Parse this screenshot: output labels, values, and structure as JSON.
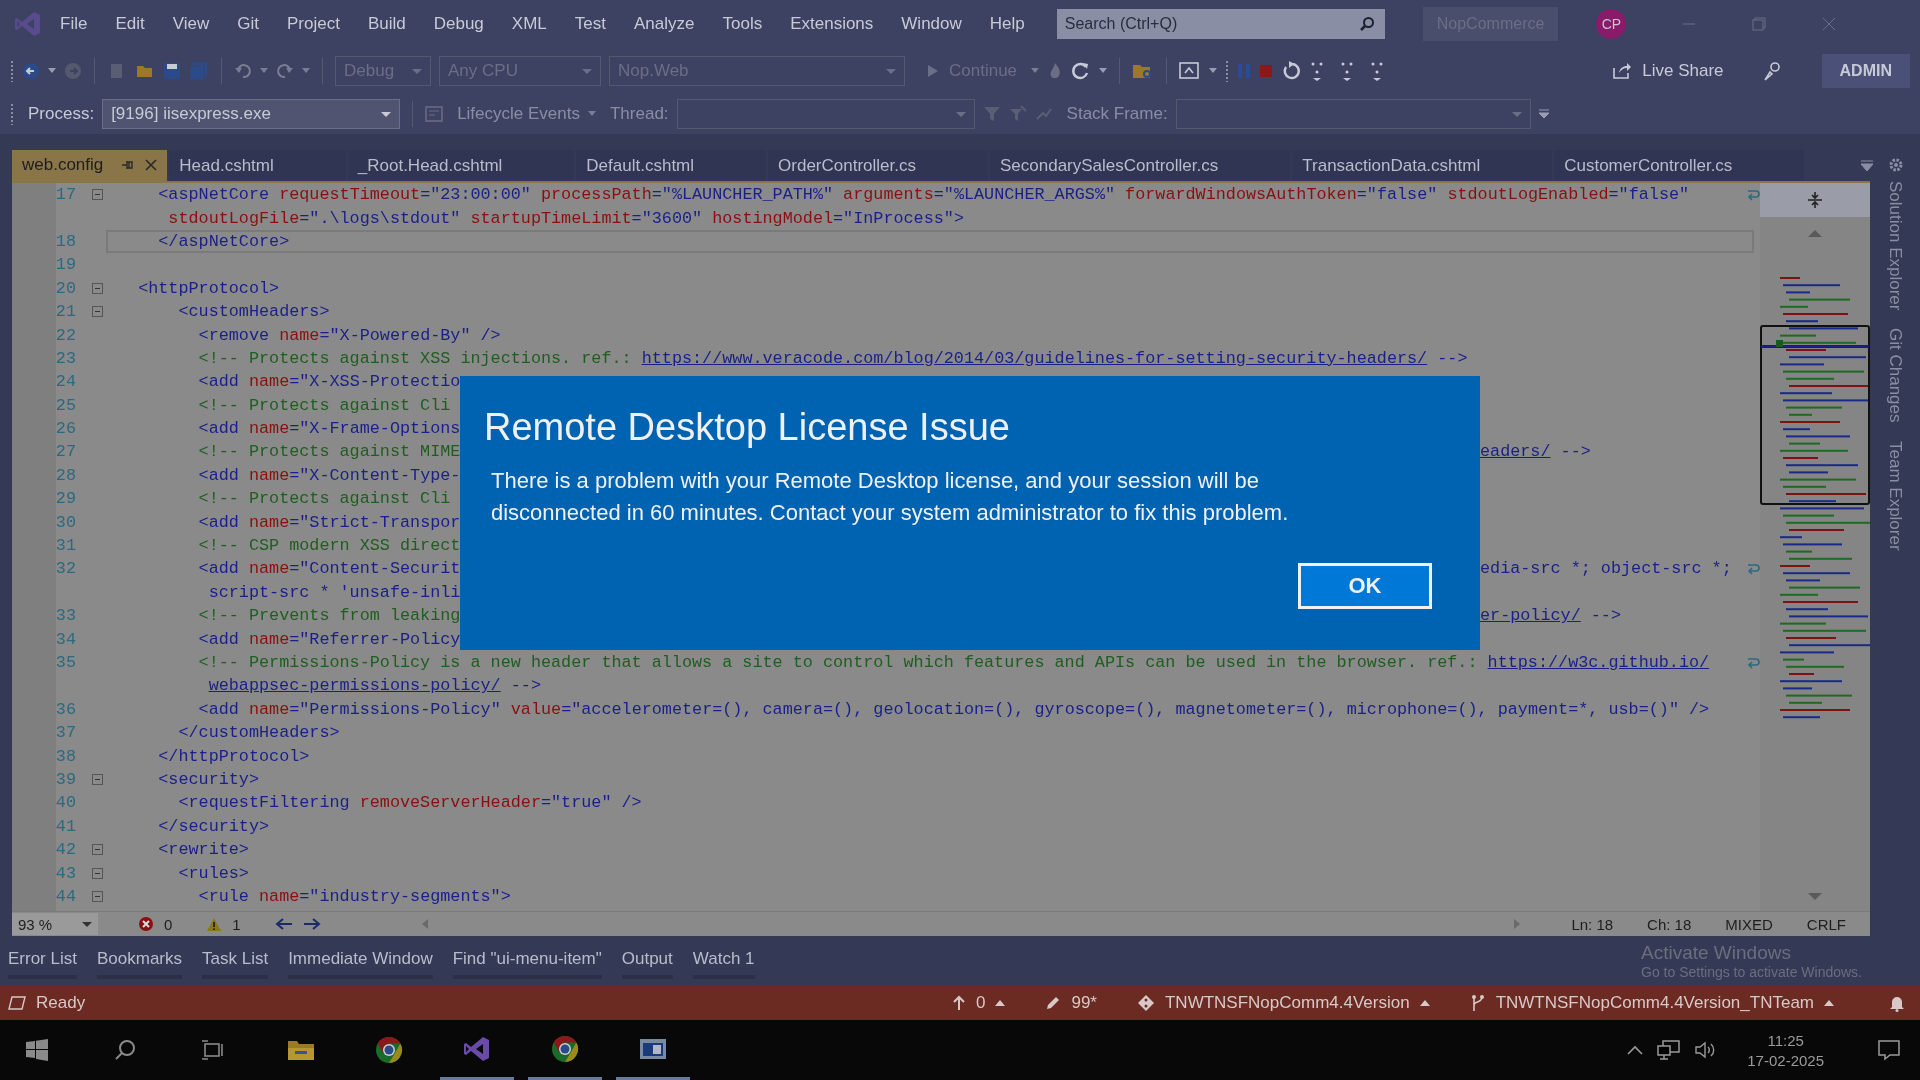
{
  "menu": {
    "items": [
      "File",
      "Edit",
      "View",
      "Git",
      "Project",
      "Build",
      "Debug",
      "XML",
      "Test",
      "Analyze",
      "Tools",
      "Extensions",
      "Window",
      "Help"
    ],
    "search": {
      "placeholder": "Search (Ctrl+Q)"
    },
    "solution": "NopCommerce",
    "avatar": "CP"
  },
  "toolbar": {
    "configuration": "Debug",
    "platform": "Any CPU",
    "startup": "Nop.Web",
    "continue": "Continue",
    "live_share": "Live Share",
    "badge": "ADMIN"
  },
  "debug_location": {
    "process_label": "Process:",
    "process": "[9196] iisexpress.exe",
    "lifecycle": "Lifecycle Events",
    "thread_label": "Thread:",
    "stack_frame_label": "Stack Frame:"
  },
  "tabs": [
    {
      "label": "web.config",
      "selected": true
    },
    {
      "label": "Head.cshtml",
      "selected": false
    },
    {
      "label": "_Root.Head.cshtml",
      "selected": false
    },
    {
      "label": "Default.cshtml",
      "selected": false
    },
    {
      "label": "OrderController.cs",
      "selected": false
    },
    {
      "label": "SecondarySalesController.cs",
      "selected": false
    },
    {
      "label": "TransactionData.cshtml",
      "selected": false
    },
    {
      "label": "CustomerController.cs",
      "selected": false
    }
  ],
  "code_rows": [
    {
      "num": "17",
      "fold": true,
      "current": false,
      "wrap_mark": true,
      "segments": [
        {
          "kind": "tag",
          "text": "    <aspNetCore"
        },
        {
          "kind": "attr",
          "text": " requestTimeout"
        },
        {
          "kind": "value",
          "text": "=\"23:00:00\""
        },
        {
          "kind": "attr",
          "text": " processPath"
        },
        {
          "kind": "value",
          "text": "=\"%LAUNCHER_PATH%\""
        },
        {
          "kind": "attr",
          "text": " arguments"
        },
        {
          "kind": "value",
          "text": "=\"%LAUNCHER_ARGS%\""
        },
        {
          "kind": "attr",
          "text": " forwardWindowsAuthToken"
        },
        {
          "kind": "value",
          "text": "=\"false\""
        },
        {
          "kind": "attr",
          "text": " stdoutLogEnabled"
        },
        {
          "kind": "value",
          "text": "=\"false\""
        }
      ]
    },
    {
      "fold": false,
      "current": false,
      "wrap_mark": false,
      "segments": [
        {
          "kind": "attr",
          "text": "stdoutLogFile"
        },
        {
          "kind": "value",
          "text": "=\".\\logs\\stdout\""
        },
        {
          "kind": "attr",
          "text": " startupTimeLimit"
        },
        {
          "kind": "value",
          "text": "=\"3600\""
        },
        {
          "kind": "attr",
          "text": " hostingModel"
        },
        {
          "kind": "value",
          "text": "=\"InProcess\">"
        }
      ]
    },
    {
      "num": "18",
      "fold": false,
      "current": true,
      "wrap_mark": false,
      "segments": [
        {
          "kind": "tag",
          "text": "    </aspNetCore>"
        }
      ]
    },
    {
      "num": "19",
      "fold": false,
      "current": false,
      "wrap_mark": false
    },
    {
      "num": "20",
      "fold": true,
      "current": false,
      "wrap_mark": false,
      "segments": [
        {
          "kind": "tag",
          "text": "  <httpProtocol>"
        }
      ]
    },
    {
      "num": "21",
      "fold": true,
      "current": false,
      "wrap_mark": false,
      "segments": [
        {
          "kind": "tag",
          "text": "      <customHeaders>"
        }
      ]
    },
    {
      "num": "22",
      "fold": false,
      "current": false,
      "wrap_mark": false,
      "segments": [
        {
          "kind": "tag",
          "text": "        <remove"
        },
        {
          "kind": "attr",
          "text": " name"
        },
        {
          "kind": "value",
          "text": "=\"X-Powered-By\" />"
        }
      ]
    },
    {
      "num": "23",
      "fold": false,
      "current": false,
      "wrap_mark": false,
      "segments": [
        {
          "kind": "comment",
          "text": "        <!-- Protects against XSS injections. ref.: "
        },
        {
          "kind": "link",
          "text": "https://www.veracode.com/blog/2014/03/guidelines-for-setting-security-headers/"
        },
        {
          "kind": "tag",
          "text": " -->"
        }
      ]
    },
    {
      "num": "24",
      "fold": false,
      "current": false,
      "wrap_mark": false,
      "segments": [
        {
          "kind": "tag",
          "text": "        <add"
        },
        {
          "kind": "attr",
          "text": " name"
        },
        {
          "kind": "value",
          "text": "=\"X-XSS-Protectio"
        }
      ]
    },
    {
      "num": "25",
      "fold": false,
      "current": false,
      "wrap_mark": false,
      "segments": [
        {
          "kind": "comment",
          "text": "        <!-- Protects against Cli"
        }
      ]
    },
    {
      "num": "26",
      "fold": false,
      "current": false,
      "wrap_mark": false,
      "segments": [
        {
          "kind": "tag",
          "text": "        <add"
        },
        {
          "kind": "attr",
          "text": " name"
        },
        {
          "kind": "value",
          "text": "=\"X-Frame-Options"
        }
      ]
    },
    {
      "num": "27",
      "fold": false,
      "current": false,
      "wrap_mark": false,
      "segments": [
        {
          "kind": "comment",
          "text": "        <!-- Protects against MIME"
        }
      ],
      "tail": [
        {
          "kind": "link",
          "text": "eaders/"
        },
        {
          "kind": "tag",
          "text": " -->"
        }
      ]
    },
    {
      "num": "28",
      "fold": false,
      "current": false,
      "wrap_mark": false,
      "segments": [
        {
          "kind": "tag",
          "text": "        <add"
        },
        {
          "kind": "attr",
          "text": " name"
        },
        {
          "kind": "value",
          "text": "=\"X-Content-Type-"
        }
      ]
    },
    {
      "num": "29",
      "fold": false,
      "current": false,
      "wrap_mark": false,
      "segments": [
        {
          "kind": "comment",
          "text": "        <!-- Protects against Cli"
        }
      ]
    },
    {
      "num": "30",
      "fold": false,
      "current": false,
      "wrap_mark": false,
      "segments": [
        {
          "kind": "tag",
          "text": "        <add"
        },
        {
          "kind": "attr",
          "text": " name"
        },
        {
          "kind": "value",
          "text": "=\"Strict-Transpor"
        }
      ]
    },
    {
      "num": "31",
      "fold": false,
      "current": false,
      "wrap_mark": false,
      "segments": [
        {
          "kind": "comment",
          "text": "        <!-- CSP modern XSS direct"
        }
      ]
    },
    {
      "num": "32",
      "fold": false,
      "current": false,
      "wrap_mark": true,
      "segments": [
        {
          "kind": "tag",
          "text": "        <add"
        },
        {
          "kind": "attr",
          "text": " name"
        },
        {
          "kind": "value",
          "text": "=\"Content-Securit"
        }
      ],
      "tail": [
        {
          "kind": "value",
          "text": "edia-src *; object-src *;"
        }
      ]
    },
    {
      "fold": false,
      "current": false,
      "wrap_mark": false,
      "segments": [
        {
          "kind": "value",
          "text": "script-src * 'unsafe-inli"
        }
      ]
    },
    {
      "num": "33",
      "fold": false,
      "current": false,
      "wrap_mark": false,
      "segments": [
        {
          "kind": "comment",
          "text": "        <!-- Prevents from leaking"
        }
      ],
      "tail": [
        {
          "kind": "link",
          "text": "er-policy/"
        },
        {
          "kind": "tag",
          "text": " -->"
        }
      ]
    },
    {
      "num": "34",
      "fold": false,
      "current": false,
      "wrap_mark": false,
      "segments": [
        {
          "kind": "tag",
          "text": "        <add"
        },
        {
          "kind": "attr",
          "text": " name"
        },
        {
          "kind": "value",
          "text": "=\"Referrer-Policy"
        }
      ]
    },
    {
      "num": "35",
      "fold": false,
      "current": false,
      "wrap_mark": true,
      "segments": [
        {
          "kind": "comment",
          "text": "        <!-- Permissions-Policy is a new header that allows a site to control which features and APIs can be used in the browser. ref.: "
        },
        {
          "kind": "link",
          "text": "https://w3c.github.io/"
        }
      ]
    },
    {
      "fold": false,
      "current": false,
      "wrap_mark": false,
      "segments": [
        {
          "kind": "link",
          "text": "webappsec-permissions-policy/"
        },
        {
          "kind": "tag",
          "text": " -->"
        }
      ]
    },
    {
      "num": "36",
      "fold": false,
      "current": false,
      "wrap_mark": false,
      "segments": [
        {
          "kind": "tag",
          "text": "        <add"
        },
        {
          "kind": "attr",
          "text": " name"
        },
        {
          "kind": "value",
          "text": "=\"Permissions-Policy\""
        },
        {
          "kind": "attr",
          "text": " value"
        },
        {
          "kind": "value",
          "text": "=\"accelerometer=(), camera=(), geolocation=(), gyroscope=(), magnetometer=(), microphone=(), payment=*, usb=()\" />"
        }
      ]
    },
    {
      "num": "37",
      "fold": false,
      "current": false,
      "wrap_mark": false,
      "segments": [
        {
          "kind": "tag",
          "text": "      </customHeaders>"
        }
      ]
    },
    {
      "num": "38",
      "fold": false,
      "current": false,
      "wrap_mark": false,
      "segments": [
        {
          "kind": "tag",
          "text": "    </httpProtocol>"
        }
      ]
    },
    {
      "num": "39",
      "fold": true,
      "current": false,
      "wrap_mark": false,
      "segments": [
        {
          "kind": "tag",
          "text": "    <security>"
        }
      ]
    },
    {
      "num": "40",
      "fold": false,
      "current": false,
      "wrap_mark": false,
      "segments": [
        {
          "kind": "tag",
          "text": "      <requestFiltering"
        },
        {
          "kind": "attr",
          "text": " removeServerHeader"
        },
        {
          "kind": "value",
          "text": "=\"true\" />"
        }
      ]
    },
    {
      "num": "41",
      "fold": false,
      "current": false,
      "wrap_mark": false,
      "segments": [
        {
          "kind": "tag",
          "text": "    </security>"
        }
      ]
    },
    {
      "num": "42",
      "fold": true,
      "current": false,
      "wrap_mark": false,
      "segments": [
        {
          "kind": "tag",
          "text": "    <rewrite>"
        }
      ]
    },
    {
      "num": "43",
      "fold": true,
      "current": false,
      "wrap_mark": false,
      "segments": [
        {
          "kind": "tag",
          "text": "      <rules>"
        }
      ]
    },
    {
      "num": "44",
      "fold": true,
      "current": false,
      "wrap_mark": false,
      "segments": [
        {
          "kind": "tag",
          "text": "        <rule"
        },
        {
          "kind": "attr",
          "text": " name"
        },
        {
          "kind": "value",
          "text": "=\"industry-segments\">"
        }
      ]
    }
  ],
  "side_tabs": [
    "Solution Explorer",
    "Git Changes",
    "Team Explorer"
  ],
  "editor_status": {
    "zoom": "93 %",
    "errors": "0",
    "warnings": "1",
    "line": "Ln: 18",
    "column": "Ch: 18",
    "encoding": "MIXED",
    "line_ending": "CRLF"
  },
  "tool_tabs": [
    "Error List",
    "Bookmarks",
    "Task List",
    "Immediate Window",
    "Find \"ui-menu-item\"",
    "Output",
    "Watch 1"
  ],
  "activation": {
    "title": "Activate Windows",
    "text": "Go to Settings to activate Windows."
  },
  "status_bar": {
    "state": "Ready",
    "pushes": "0",
    "changes": "99*",
    "repository": "TNWTNSFNopComm4.4Version",
    "branch": "TNWTNSFNopComm4.4Version_TNTeam"
  },
  "taskbar": {
    "time": "11:25",
    "date": "17-02-2025"
  },
  "dialog": {
    "title": "Remote Desktop License Issue",
    "message": "There is a problem with your Remote Desktop license, and your session will be disconnected in 60 minutes. Contact your system administrator to fix this problem.",
    "button": "OK"
  }
}
